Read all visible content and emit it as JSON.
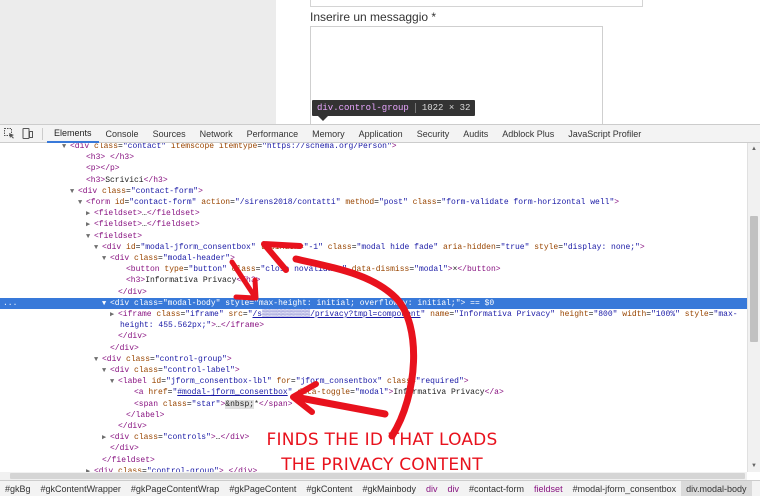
{
  "page": {
    "message_label": "Inserire un messaggio *"
  },
  "tooltip": {
    "selector": "div.control-group",
    "size": "1022 × 32"
  },
  "toolbar": {
    "tabs": [
      {
        "label": "Elements",
        "active": true
      },
      {
        "label": "Console"
      },
      {
        "label": "Sources"
      },
      {
        "label": "Network"
      },
      {
        "label": "Performance"
      },
      {
        "label": "Memory"
      },
      {
        "label": "Application"
      },
      {
        "label": "Security"
      },
      {
        "label": "Audits"
      },
      {
        "label": "Adblock Plus"
      },
      {
        "label": "JavaScript Profiler"
      }
    ]
  },
  "tree": [
    {
      "indent": 70,
      "tri": "▼",
      "html": "<span class='t'>&lt;div</span> <span class='a'>class</span>=<span class='v'>\"contact\"</span> <span class='a'>itemscope</span> <span class='a'>itemtype</span>=<span class='v'>\"https://schema.org/Person\"</span><span class='t'>&gt;</span>"
    },
    {
      "indent": 86,
      "tri": "",
      "html": "<span class='t'>&lt;h3&gt;</span>  <span class='t'>&lt;/h3&gt;</span>"
    },
    {
      "indent": 86,
      "tri": "",
      "html": "<span class='t'>&lt;p&gt;&lt;/p&gt;</span>"
    },
    {
      "indent": 86,
      "tri": "",
      "html": "<span class='t'>&lt;h3&gt;</span><span class='txt'>Scrivici</span><span class='t'>&lt;/h3&gt;</span>"
    },
    {
      "indent": 78,
      "tri": "▼",
      "html": "<span class='t'>&lt;div</span> <span class='a'>class</span>=<span class='v'>\"contact-form\"</span><span class='t'>&gt;</span>"
    },
    {
      "indent": 86,
      "tri": "▼",
      "html": "<span class='t'>&lt;form</span> <span class='a'>id</span>=<span class='v'>\"contact-form\"</span> <span class='a'>action</span>=<span class='v'>\"/sirens2018/contatti\"</span> <span class='a'>method</span>=<span class='v'>\"post\"</span> <span class='a'>class</span>=<span class='v'>\"form-validate form-horizontal well\"</span><span class='t'>&gt;</span>"
    },
    {
      "indent": 94,
      "tri": "▶",
      "html": "<span class='t'>&lt;fieldset&gt;</span>…<span class='t'>&lt;/fieldset&gt;</span>"
    },
    {
      "indent": 94,
      "tri": "▶",
      "html": "<span class='t'>&lt;fieldset&gt;</span>…<span class='t'>&lt;/fieldset&gt;</span>"
    },
    {
      "indent": 94,
      "tri": "▼",
      "html": "<span class='t'>&lt;fieldset&gt;</span>"
    },
    {
      "indent": 102,
      "tri": "▼",
      "html": "<span class='t'>&lt;div</span> <span class='a'>id</span>=<span class='v'>\"modal-jform_consentbox\"</span> <span class='a'>tabindex</span>=<span class='v'>\"-1\"</span> <span class='a'>class</span>=<span class='v'>\"modal hide fade\"</span> <span class='a'>aria-hidden</span>=<span class='v'>\"true\"</span> <span class='a'>style</span>=<span class='v'>\"display: none;\"</span><span class='t'>&gt;</span>"
    },
    {
      "indent": 110,
      "tri": "▼",
      "html": "<span class='t'>&lt;div</span> <span class='a'>class</span>=<span class='v'>\"modal-header\"</span><span class='t'>&gt;</span>"
    },
    {
      "indent": 126,
      "tri": "",
      "html": "<span class='t'>&lt;button</span> <span class='a'>type</span>=<span class='v'>\"button\"</span> <span class='a'>class</span>=<span class='v'>\"close novalidate\"</span> <span class='a'>data-dismiss</span>=<span class='v'>\"modal\"</span><span class='t'>&gt;</span>×<span class='t'>&lt;/button&gt;</span>"
    },
    {
      "indent": 126,
      "tri": "",
      "html": "<span class='t'>&lt;h3&gt;</span><span class='txt'>Informativa Privacy</span><span class='t'>&lt;/h3&gt;</span>"
    },
    {
      "indent": 118,
      "tri": "",
      "html": "<span class='t'>&lt;/div&gt;</span>"
    },
    {
      "indent": 110,
      "tri": "▼",
      "sel": true,
      "html": "<span class='t'>&lt;div</span> <span class='a'>class</span>=<span class='v'>\"modal-body\"</span> <span class='a'>style</span>=<span class='v'>\"max-height: initial; overflow-y: initial;\"</span><span class='t'>&gt;</span> <span class='eq'>== $0</span>"
    },
    {
      "indent": 118,
      "tri": "▶",
      "html": "<span class='t'>&lt;iframe</span> <span class='a'>class</span>=<span class='v'>\"iframe\"</span> <span class='a'>src</span>=<span class='v'>\"<u>/s▒▒▒▒▒▒▒▒▒▒/privacy?tmpl=component</u>\"</span> <span class='a'>name</span>=<span class='v'>\"Informativa Privacy\"</span> <span class='a'>height</span>=<span class='v'>\"800\"</span> <span class='a'>width</span>=<span class='v'>\"100%\"</span> <span class='a'>style</span>=<span class='v'>\"max-</span>"
    },
    {
      "indent": 120,
      "tri": "",
      "html": "<span class='v'>height: 455.562px;\"</span><span class='t'>&gt;</span>…<span class='t'>&lt;/iframe&gt;</span>"
    },
    {
      "indent": 118,
      "tri": "",
      "html": "<span class='t'>&lt;/div&gt;</span>"
    },
    {
      "indent": 110,
      "tri": "",
      "html": "<span class='t'>&lt;/div&gt;</span>"
    },
    {
      "indent": 102,
      "tri": "▼",
      "html": "<span class='t'>&lt;div</span> <span class='a'>class</span>=<span class='v'>\"control-group\"</span><span class='t'>&gt;</span>"
    },
    {
      "indent": 110,
      "tri": "▼",
      "html": "<span class='t'>&lt;div</span> <span class='a'>class</span>=<span class='v'>\"control-label\"</span><span class='t'>&gt;</span>"
    },
    {
      "indent": 118,
      "tri": "▼",
      "html": "<span class='t'>&lt;label</span> <span class='a'>id</span>=<span class='v'>\"jform_consentbox-lbl\"</span> <span class='a'>for</span>=<span class='v'>\"jform_consentbox\"</span> <span class='a'>class</span>=<span class='v'>\"required\"</span><span class='t'>&gt;</span>"
    },
    {
      "indent": 134,
      "tri": "",
      "html": "<span class='t'>&lt;a</span> <span class='a'>href</span>=<span class='v'>\"<u>#modal-jform_consentbox</u>\"</span> <span class='a'>data-toggle</span>=<span class='v'>\"modal\"</span><span class='t'>&gt;</span><span class='txt'>Informativa Privacy</span><span class='t'>&lt;/a&gt;</span>"
    },
    {
      "indent": 134,
      "tri": "",
      "html": "<span class='t'>&lt;span</span> <span class='a'>class</span>=<span class='v'>\"star\"</span><span class='t'>&gt;</span><span class='hl'>&amp;nbsp;</span>*<span class='t'>&lt;/span&gt;</span>"
    },
    {
      "indent": 126,
      "tri": "",
      "html": "<span class='t'>&lt;/label&gt;</span>"
    },
    {
      "indent": 118,
      "tri": "",
      "html": "<span class='t'>&lt;/div&gt;</span>"
    },
    {
      "indent": 110,
      "tri": "▶",
      "html": "<span class='t'>&lt;div</span> <span class='a'>class</span>=<span class='v'>\"controls\"</span><span class='t'>&gt;</span>…<span class='t'>&lt;/div&gt;</span>"
    },
    {
      "indent": 110,
      "tri": "",
      "html": "<span class='t'>&lt;/div&gt;</span>"
    },
    {
      "indent": 102,
      "tri": "",
      "html": "<span class='t'>&lt;/fieldset&gt;</span>"
    },
    {
      "indent": 94,
      "tri": "▶",
      "html": "<span class='t'>&lt;div</span> <span class='a'>class</span>=<span class='v'>\"control-group\"</span><span class='t'>&gt;</span>…<span class='t'>&lt;/div&gt;</span>"
    }
  ],
  "breadcrumbs": [
    {
      "label": "#gkBg",
      "tagonly": false
    },
    {
      "label": "#gkContentWrapper",
      "tagonly": false
    },
    {
      "label": "#gkPageContentWrap",
      "tagonly": false
    },
    {
      "label": "#gkPageContent",
      "tagonly": false
    },
    {
      "label": "#gkContent",
      "tagonly": false
    },
    {
      "label": "#gkMainbody",
      "tagonly": false
    },
    {
      "label": "div",
      "tagonly": true
    },
    {
      "label": "div",
      "tagonly": true
    },
    {
      "label": "#contact-form",
      "tagonly": false
    },
    {
      "label": "fieldset",
      "tagonly": true
    },
    {
      "label": "#modal-jform_consentbox",
      "tagonly": false
    },
    {
      "label": "div.modal-body",
      "tagonly": false,
      "last": true
    }
  ],
  "annotation": {
    "line1": "FINDS THE ID THAT LOADS",
    "line2": "THE PRIVACY CONTENT",
    "color": "#e8121d"
  },
  "colors": {
    "selection": "#3879d9",
    "tag": "#881280",
    "attr_name": "#994500",
    "attr_value": "#1a1aa6"
  }
}
